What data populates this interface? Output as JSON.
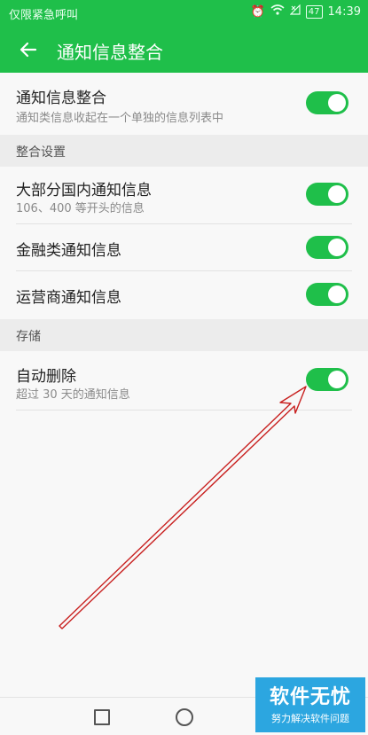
{
  "status": {
    "carrier": "仅限紧急呼叫",
    "battery": "47",
    "time": "14:39"
  },
  "appbar": {
    "title": "通知信息整合"
  },
  "main_setting": {
    "title": "通知信息整合",
    "subtitle": "通知类信息收起在一个单独的信息列表中",
    "enabled": true
  },
  "section_integration": {
    "label": "整合设置",
    "items": [
      {
        "title": "大部分国内通知信息",
        "subtitle": "106、400 等开头的信息",
        "enabled": true
      },
      {
        "title": "金融类通知信息",
        "enabled": true
      },
      {
        "title": "运营商通知信息",
        "enabled": true
      }
    ]
  },
  "section_storage": {
    "label": "存储",
    "items": [
      {
        "title": "自动删除",
        "subtitle": "超过 30 天的通知信息",
        "enabled": true
      }
    ]
  },
  "watermark": {
    "title": "软件无忧",
    "subtitle": "努力解决软件问题"
  },
  "colors": {
    "accent": "#1fbf4a",
    "arrow": "#c8201f",
    "watermark_bg": "#2ca6e0"
  }
}
